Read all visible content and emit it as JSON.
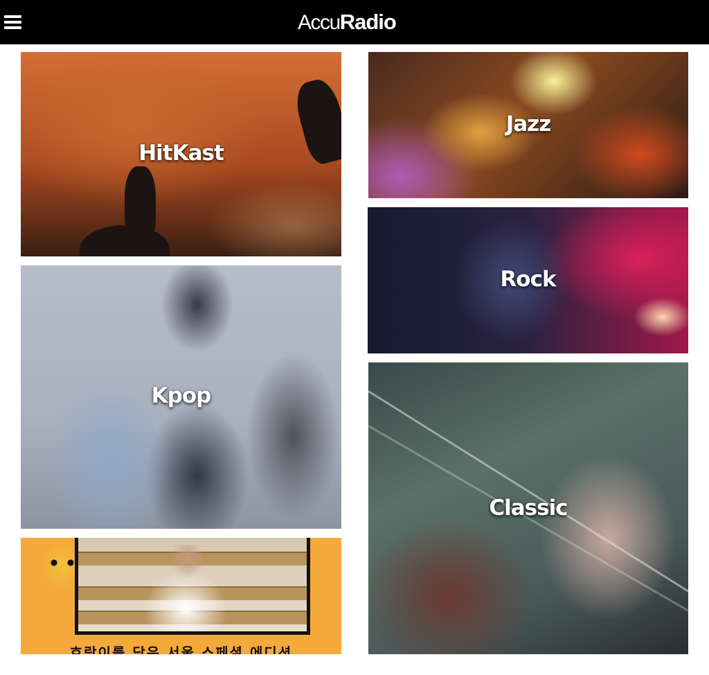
{
  "header": {
    "logo_part1": "Accu",
    "logo_part2": "Radio",
    "menu_icon": "hamburger-menu-icon",
    "background": "#000000"
  },
  "tiles": [
    {
      "label": "HitKast"
    },
    {
      "label": "Jazz"
    },
    {
      "label": "Rock"
    },
    {
      "label": "Kpop"
    },
    {
      "label": "Classic"
    },
    {
      "caption": "호랑이를 담은 서울 스페셜 에디션"
    }
  ],
  "colors": {
    "accent": "#ffffff",
    "promo_background": "#f5a93a"
  }
}
